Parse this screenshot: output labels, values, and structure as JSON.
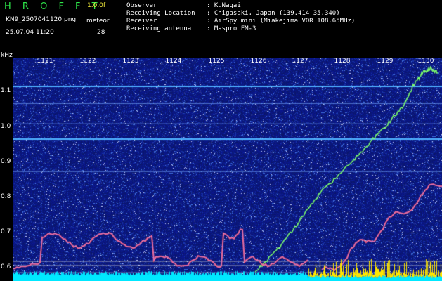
{
  "header": {
    "title": "H R O F F T",
    "version": "1.0.0f",
    "filename": "KN9_2507041120.png",
    "datetime": "25.07.04 11:20",
    "meteor_label": "meteor",
    "meteor_count": "28"
  },
  "info": [
    {
      "key": "Observer",
      "value": ": K.Nagai"
    },
    {
      "key": "Receiving Location",
      "value": ": Chigasaki, Japan (139.414 35.340)"
    },
    {
      "key": "Receiver",
      "value": ": AirSpy mini (Miakejima VOR 108.65MHz)"
    },
    {
      "key": "Receiving antenna",
      "value": ": Maspro FM-3"
    }
  ],
  "axis": {
    "y_unit": "kHz",
    "y_ticks": [
      "1.1",
      "1.0",
      "0.9",
      "0.8",
      "0.7",
      "0.6"
    ],
    "x_ticks": [
      "1121",
      "1122",
      "1123",
      "1124",
      "1125",
      "1126",
      "1127",
      "1128",
      "1129",
      "1130"
    ]
  },
  "colors": {
    "background": "#000000",
    "spectrum_base": "#0c1a6e",
    "carrier_line": "#4fb0ff",
    "trace_green": "#7dff6a",
    "trace_red": "#ff5a6a",
    "level_cyan": "#00e8ff",
    "level_yellow": "#ffe600",
    "title_green": "#2ee84a",
    "version_yellow": "#f2ec3a"
  }
}
